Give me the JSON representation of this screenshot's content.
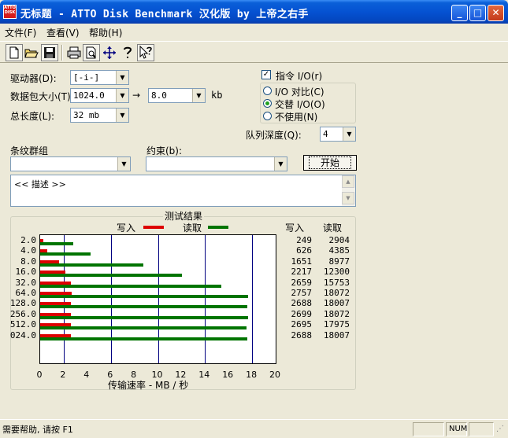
{
  "window": {
    "title": "无标题 - ATTO Disk Benchmark  汉化版 by 上帝之右手",
    "icon_text": "ATTO DISK",
    "controls": {
      "minimize": "_",
      "maximize": "□",
      "close": "✕"
    }
  },
  "menu": [
    {
      "label": "文件(F)"
    },
    {
      "label": "查看(V)"
    },
    {
      "label": "帮助(H)"
    }
  ],
  "toolbar": {
    "icons": [
      "new-document-icon",
      "open-folder-icon",
      "save-icon",
      "print-icon",
      "print-preview-icon",
      "move-icon",
      "help-icon",
      "context-help-icon"
    ]
  },
  "settings": {
    "drive_label": "驱动器(D):",
    "drive_value": "[-i-]",
    "transfer_label": "数据包大小(T):",
    "transfer_from": "1024.0",
    "transfer_arrow": "→",
    "transfer_to": "8.0",
    "transfer_unit": "kb",
    "total_label": "总长度(L):",
    "total_value": "32 mb",
    "direct_io_label": "指令 I/O(r)",
    "direct_io_checked": true,
    "io_options": [
      {
        "label": "I/O 对比(C)",
        "selected": false
      },
      {
        "label": "交替 I/O(O)",
        "selected": true
      },
      {
        "label": "不使用(N)",
        "selected": false
      }
    ],
    "queue_depth_label": "队列深度(Q):",
    "queue_depth_value": "4",
    "stripe_group_label": "条纹群组",
    "stripe_group_value": "",
    "constraint_label": "约束(b):",
    "constraint_value": "",
    "start_button": "开始"
  },
  "description": {
    "text": "<< 描述 >>"
  },
  "results": {
    "title": "测试结果",
    "legend_write": "写入",
    "legend_read": "读取",
    "col_write_header": "写入",
    "col_read_header": "读取",
    "xlabel": "传输速率 - MB / 秒",
    "colors": {
      "write": "#dd0000",
      "read": "#007400",
      "grid": "#000080"
    }
  },
  "chart_data": {
    "type": "bar",
    "orientation": "horizontal",
    "title": "测试结果",
    "xlabel": "传输速率 - MB / 秒",
    "xlim": [
      0,
      20
    ],
    "xticks": [
      "0",
      "2",
      "4",
      "6",
      "8",
      "10",
      "12",
      "14",
      "16",
      "18",
      "20"
    ],
    "categories": [
      "2.0",
      "4.0",
      "8.0",
      "16.0",
      "32.0",
      "64.0",
      "128.0",
      "256.0",
      "512.0",
      "024.0"
    ],
    "series": [
      {
        "name": "写入",
        "values": [
          0.24,
          0.61,
          1.61,
          2.17,
          2.6,
          2.69,
          2.62,
          2.64,
          2.63,
          2.63
        ]
      },
      {
        "name": "读取",
        "values": [
          2.84,
          4.28,
          8.77,
          12.01,
          15.38,
          17.65,
          17.59,
          17.65,
          17.55,
          17.59
        ]
      }
    ],
    "write_values": [
      "249",
      "626",
      "1651",
      "2217",
      "2659",
      "2757",
      "2688",
      "2699",
      "2695",
      "2688"
    ],
    "read_values": [
      "2904",
      "4385",
      "8977",
      "12300",
      "15753",
      "18072",
      "18007",
      "18072",
      "17975",
      "18007"
    ],
    "grid": true,
    "legend": "top"
  },
  "status": {
    "text": "需要帮助, 请按 F1",
    "num": "NUM"
  }
}
